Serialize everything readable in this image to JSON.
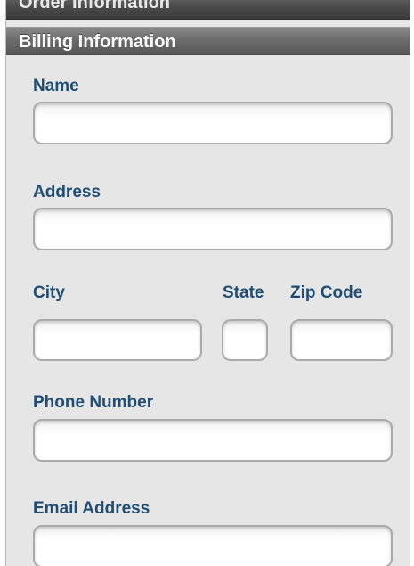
{
  "sections": {
    "order_information": "Order Information",
    "billing_information": "Billing Information"
  },
  "fields": {
    "name": {
      "label": "Name",
      "value": ""
    },
    "address": {
      "label": "Address",
      "value": ""
    },
    "city": {
      "label": "City",
      "value": ""
    },
    "state": {
      "label": "State",
      "value": ""
    },
    "zip_code": {
      "label": "Zip Code",
      "value": ""
    },
    "phone_number": {
      "label": "Phone Number",
      "value": ""
    },
    "email_address": {
      "label": "Email Address",
      "value": ""
    }
  },
  "colors": {
    "label_text": "#1f4d73",
    "panel_background": "#e6e6e7",
    "header_gradient_top": "#8a8a8a",
    "header_gradient_bottom": "#575757"
  }
}
